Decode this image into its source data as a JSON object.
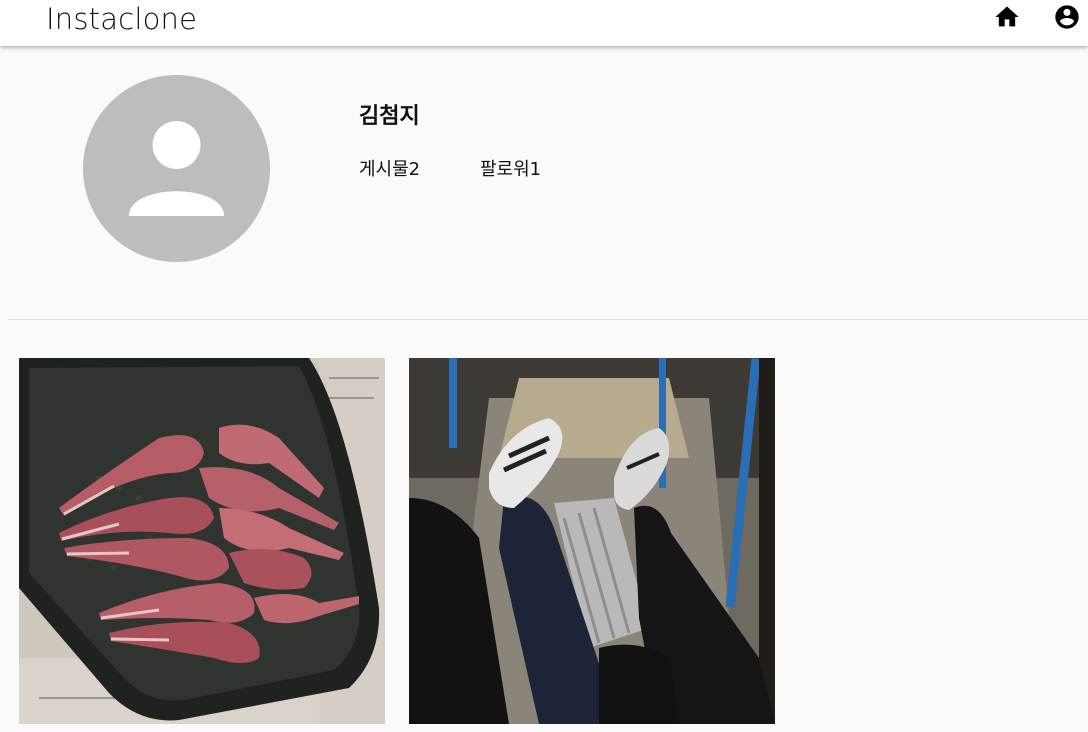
{
  "app": {
    "title": "Instaclone"
  },
  "nav": [
    {
      "name": "home",
      "icon": "home-icon"
    },
    {
      "name": "account",
      "icon": "account-circle-icon"
    }
  ],
  "profile": {
    "username": "김첨지",
    "posts_stat": "게시물2",
    "followers_stat": "팔로워1",
    "avatar_icon": "person-icon",
    "avatar_color": "#bdbdbd"
  },
  "posts": [
    {
      "subject": "raw lamb chops on a baking tray"
    },
    {
      "subject": "legs in sneakers next to a silver suitcase on a bus"
    }
  ]
}
